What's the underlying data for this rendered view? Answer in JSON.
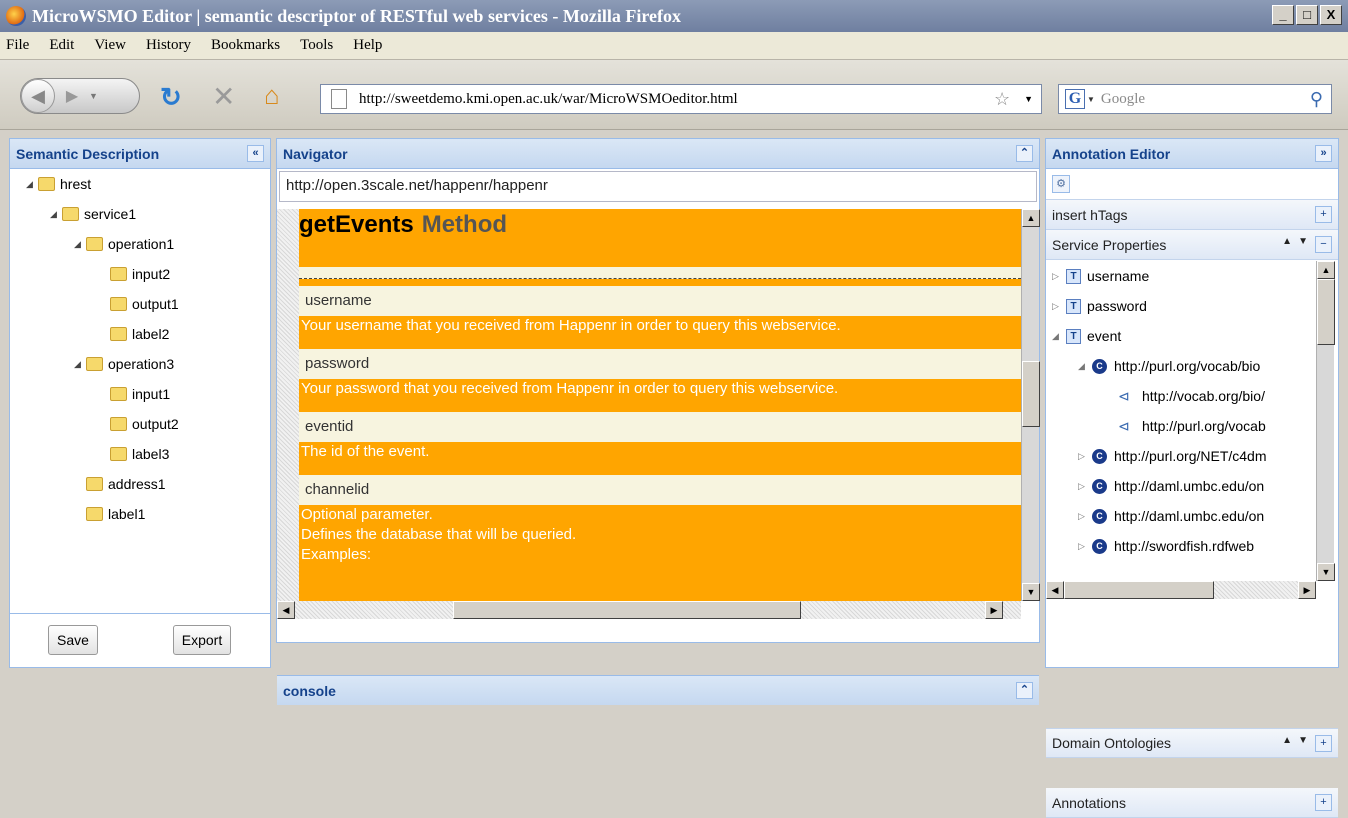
{
  "window": {
    "title": "MicroWSMO Editor | semantic descriptor of RESTful web services - Mozilla Firefox",
    "buttons": [
      "_",
      "□",
      "X"
    ]
  },
  "menu": [
    "File",
    "Edit",
    "View",
    "History",
    "Bookmarks",
    "Tools",
    "Help"
  ],
  "toolbar": {
    "url": "http://sweetdemo.kmi.open.ac.uk/war/MicroWSMOeditor.html",
    "search_placeholder": "Google",
    "search_engine": "G"
  },
  "semantic": {
    "title": "Semantic Description",
    "tree": [
      {
        "label": "hrest",
        "level": 0,
        "expanded": true
      },
      {
        "label": "service1",
        "level": 1,
        "expanded": true
      },
      {
        "label": "operation1",
        "level": 2,
        "expanded": true
      },
      {
        "label": "input2",
        "level": 3
      },
      {
        "label": "output1",
        "level": 3
      },
      {
        "label": "label2",
        "level": 3
      },
      {
        "label": "operation3",
        "level": 2,
        "expanded": true
      },
      {
        "label": "input1",
        "level": 3
      },
      {
        "label": "output2",
        "level": 3
      },
      {
        "label": "label3",
        "level": 3
      },
      {
        "label": "address1",
        "level": 2
      },
      {
        "label": "label1",
        "level": 2
      }
    ],
    "save_label": "Save",
    "export_label": "Export"
  },
  "navigator": {
    "title": "Navigator",
    "url": "http://open.3scale.net/happenr/happenr",
    "method_name": "getEvents",
    "method_word": "Method",
    "params": [
      {
        "name": "username",
        "desc": "Your username that you received from Happenr in order to query this webservice."
      },
      {
        "name": "password",
        "desc": "Your password that you received from Happenr in order to query this webservice."
      },
      {
        "name": "eventid",
        "desc": "The id of the event."
      },
      {
        "name": "channelid",
        "desc": "Optional parameter.\nDefines the database that will be queried.\nExamples:"
      }
    ],
    "console_label": "console"
  },
  "annotation": {
    "title": "Annotation Editor",
    "insert_htags": "insert hTags",
    "service_properties": "Service Properties",
    "props": [
      {
        "type": "T",
        "label": "username",
        "level": 0,
        "arrow": "▷"
      },
      {
        "type": "T",
        "label": "password",
        "level": 0,
        "arrow": "▷"
      },
      {
        "type": "T",
        "label": "event",
        "level": 0,
        "arrow": "◢"
      },
      {
        "type": "C",
        "label": "http://purl.org/vocab/bio",
        "level": 1,
        "arrow": "◢"
      },
      {
        "type": "P",
        "label": "http://vocab.org/bio/",
        "level": 2,
        "arrow": ""
      },
      {
        "type": "P",
        "label": "http://purl.org/vocab",
        "level": 2,
        "arrow": ""
      },
      {
        "type": "C",
        "label": "http://purl.org/NET/c4dm",
        "level": 1,
        "arrow": "▷"
      },
      {
        "type": "C",
        "label": "http://daml.umbc.edu/on",
        "level": 1,
        "arrow": "▷"
      },
      {
        "type": "C",
        "label": "http://daml.umbc.edu/on",
        "level": 1,
        "arrow": "▷"
      },
      {
        "type": "C",
        "label": "http://swordfish.rdfweb",
        "level": 1,
        "arrow": "▷"
      }
    ],
    "domain_ontologies": "Domain Ontologies",
    "annotations": "Annotations"
  }
}
